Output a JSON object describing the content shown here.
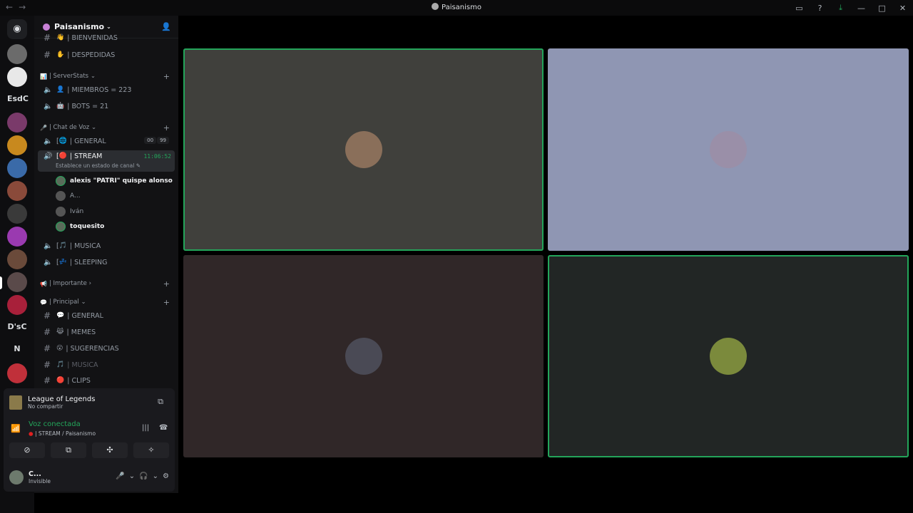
{
  "window": {
    "title": "Paisanismo"
  },
  "servers": [
    {
      "label": "EsdC"
    },
    {
      "label": "D'sC"
    },
    {
      "label": "N"
    }
  ],
  "guild": {
    "name": "Paisanismo"
  },
  "channels_top": [
    {
      "name": "| BIENVENIDAS",
      "emoji": "👋"
    },
    {
      "name": "| DESPEDIDAS",
      "emoji": "✋"
    }
  ],
  "cat_serverstats": {
    "name": "| ServerStats",
    "emoji": "📊"
  },
  "stats": [
    {
      "name": "| MIEMBROS = 223",
      "emoji": "👤"
    },
    {
      "name": "| BOTS = 21",
      "emoji": "🤖"
    }
  ],
  "cat_voice": {
    "name": "| Chat de Voz",
    "emoji": "🎤"
  },
  "voice_general": {
    "name": "| GENERAL",
    "prefix": "[",
    "emoji": "🌐",
    "badge_a": "00",
    "badge_b": "99"
  },
  "voice_stream": {
    "name": "| STREAM",
    "prefix": "[",
    "timer": "11:06:52",
    "sub": "Establece un estado de canal"
  },
  "voice_users": [
    {
      "name": "alexis \"PATRI\" quispe alonso",
      "speaking": true
    },
    {
      "name": "A...",
      "speaking": false
    },
    {
      "name": "Iván",
      "speaking": false
    },
    {
      "name": "toquesito",
      "speaking": true
    }
  ],
  "voice_music": {
    "name": "| MUSICA",
    "prefix": "[",
    "emoji": "🎵"
  },
  "voice_sleep": {
    "name": "| SLEEPING",
    "prefix": "[",
    "emoji": "💤"
  },
  "cat_importante": {
    "name": "| Importante",
    "emoji": "📢"
  },
  "cat_principal": {
    "name": "| Principal",
    "emoji": "💬"
  },
  "text_principal": [
    {
      "name": "| GENERAL",
      "emoji": "💬"
    },
    {
      "name": "| MEMES",
      "emoji": "😹"
    },
    {
      "name": "| SUGERENCIAS",
      "emoji": "😮"
    },
    {
      "name": "| MUSICA",
      "emoji": "🎵"
    },
    {
      "name": "| CLIPS",
      "emoji": "🔴"
    }
  ],
  "activity": {
    "title": "League of Legends",
    "subtitle": "No compartir"
  },
  "voice_status": {
    "title": "Voz conectada",
    "channel": "| STREAM / Paisanismo"
  },
  "me": {
    "name": "C...",
    "status": "Invisible"
  },
  "tiles": [
    {
      "color": "#40403c",
      "speaking": true,
      "avatar_color": "#8a6f5a"
    },
    {
      "color": "#8f96b3",
      "speaking": false,
      "avatar_color": "#9a8fa8"
    },
    {
      "color": "#302728",
      "speaking": false,
      "avatar_color": "#4a4a55"
    },
    {
      "color": "#222625",
      "speaking": true,
      "avatar_color": "#7b8a3c"
    }
  ]
}
